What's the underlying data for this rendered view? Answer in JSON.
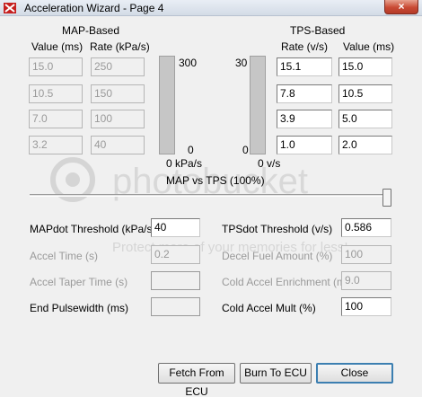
{
  "window": {
    "title": "Acceleration Wizard - Page 4",
    "close_glyph": "×"
  },
  "map": {
    "header": "MAP-Based",
    "value_header": "Value (ms)",
    "rate_header": "Rate (kPa/s)",
    "values": [
      "15.0",
      "10.5",
      "7.0",
      "3.2"
    ],
    "rates": [
      "250",
      "150",
      "100",
      "40"
    ],
    "bar_max": "300",
    "bar_min": "0",
    "bar_unit": "0 kPa/s"
  },
  "tps": {
    "header": "TPS-Based",
    "rate_header": "Rate (v/s)",
    "value_header": "Value (ms)",
    "rates": [
      "15.1",
      "7.8",
      "3.9",
      "1.0"
    ],
    "values": [
      "15.0",
      "10.5",
      "5.0",
      "2.0"
    ],
    "bar_max": "30",
    "bar_min": "0",
    "bar_unit": "0 v/s"
  },
  "slider": {
    "label": "MAP vs TPS (100%)",
    "value_percent": 100
  },
  "fields": {
    "mapdot_label": "MAPdot Threshold (kPa/s)",
    "mapdot_value": "40",
    "tpsdot_label": "TPSdot Threshold (v/s)",
    "tpsdot_value": "0.586",
    "accel_time_label": "Accel Time (s)",
    "accel_time_value": "0.2",
    "decel_fuel_label": "Decel Fuel Amount (%)",
    "decel_fuel_value": "100",
    "accel_taper_label": "Accel Taper Time (s)",
    "accel_taper_value": "",
    "cold_enrich_label": "Cold Accel Enrichment (ms)",
    "cold_enrich_value": "9.0",
    "end_pw_label": "End Pulsewidth (ms)",
    "end_pw_value": "",
    "cold_mult_label": "Cold Accel Mult (%)",
    "cold_mult_value": "100"
  },
  "buttons": {
    "fetch": "Fetch From ECU",
    "burn": "Burn To ECU",
    "close": "Close"
  },
  "watermark": {
    "line1": "Protect more of your memories for less!",
    "brand": "photobucket"
  },
  "colors": {
    "accent": "#3c7fb1",
    "bar_fill": "#c6c6c6",
    "close_red": "#c94a34"
  }
}
